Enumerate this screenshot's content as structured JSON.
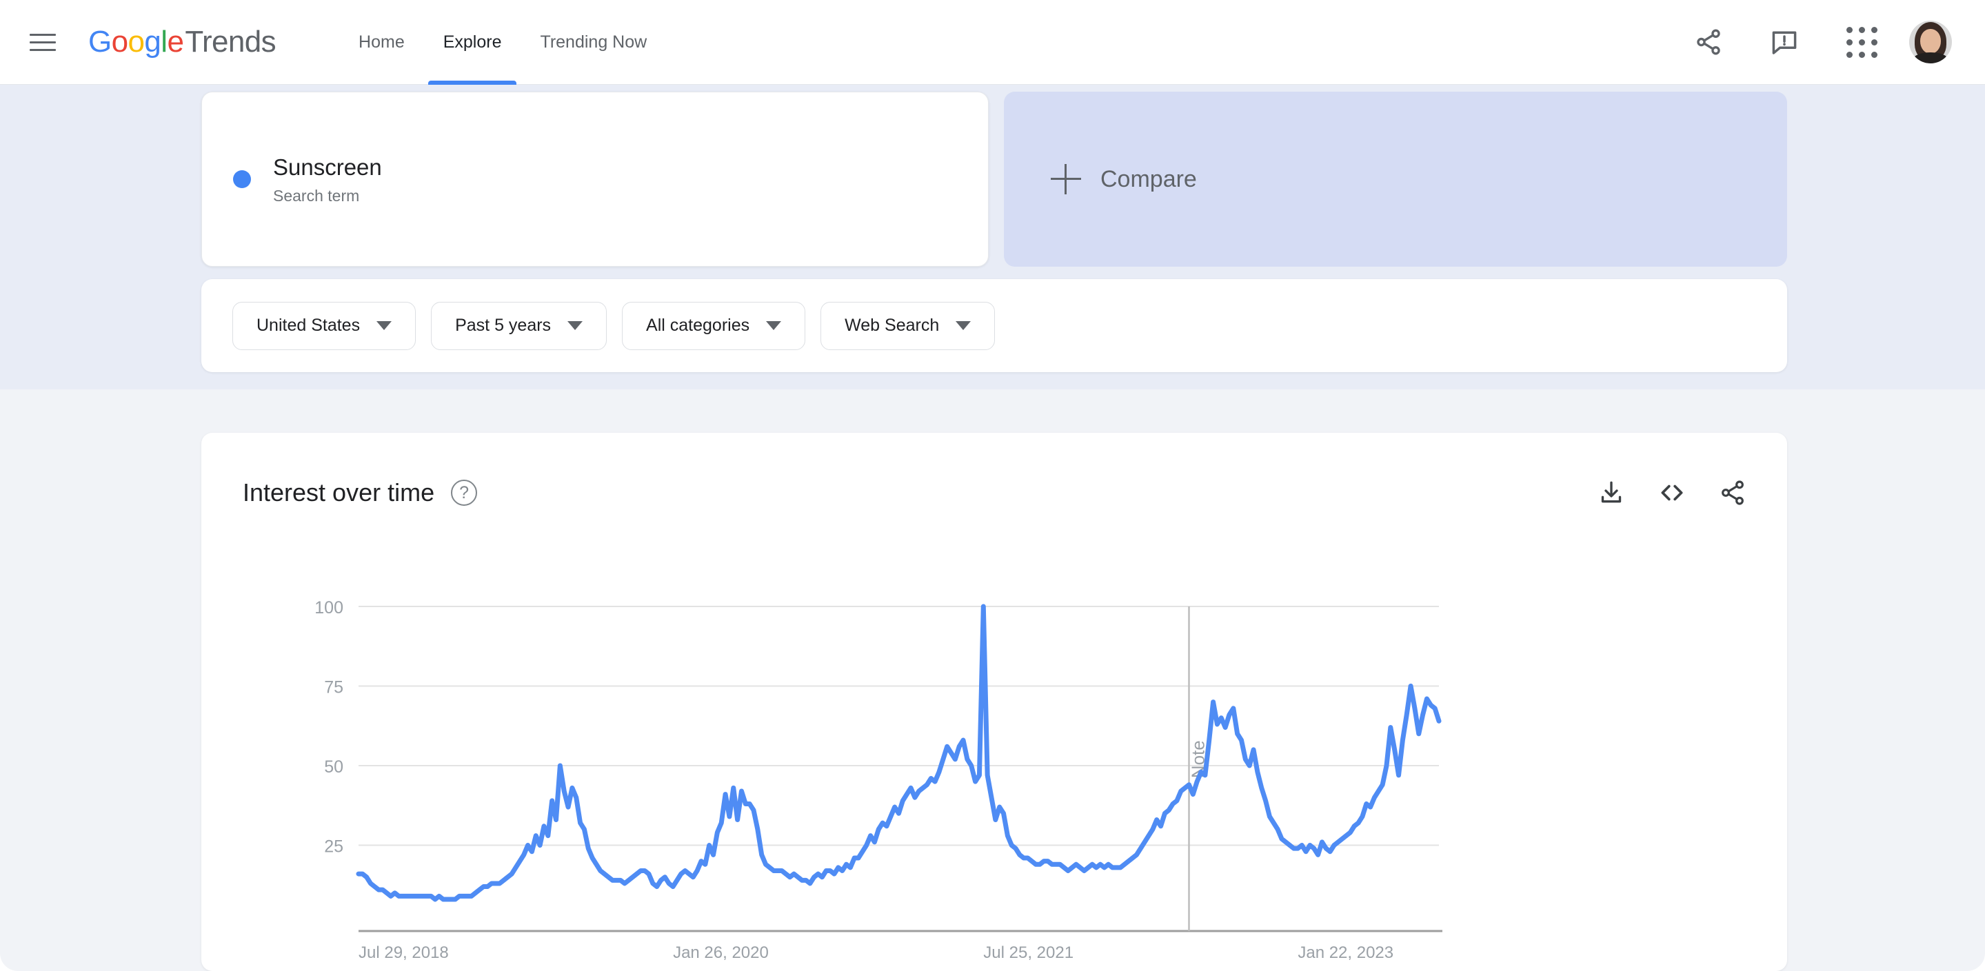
{
  "header": {
    "menu_icon": "hamburger-menu-icon",
    "brand": {
      "g1": "G",
      "o1": "o",
      "o2": "o",
      "g2": "g",
      "l1": "l",
      "e1": "e",
      "trends": "Trends"
    },
    "nav": [
      {
        "label": "Home",
        "active": false
      },
      {
        "label": "Explore",
        "active": true
      },
      {
        "label": "Trending Now",
        "active": false
      }
    ],
    "icons": [
      "share-icon",
      "feedback-icon",
      "google-apps-icon",
      "account-avatar"
    ]
  },
  "query": {
    "term": {
      "name": "Sunscreen",
      "kind": "Search term",
      "color": "#4285F4"
    },
    "compare": {
      "label": "Compare",
      "icon": "plus-icon"
    }
  },
  "filters": [
    {
      "name": "location",
      "label": "United States"
    },
    {
      "name": "time-range",
      "label": "Past 5 years"
    },
    {
      "name": "category",
      "label": "All categories"
    },
    {
      "name": "search-type",
      "label": "Web Search"
    }
  ],
  "chart_card": {
    "title": "Interest over time",
    "help": "?",
    "actions": [
      "download-icon",
      "embed-code-icon",
      "share-icon"
    ]
  },
  "chart_data": {
    "type": "line",
    "title": "Interest over time",
    "xlabel": "",
    "ylabel": "",
    "ylim": [
      0,
      100
    ],
    "yticks": [
      100,
      75,
      50,
      25
    ],
    "grid": true,
    "legend": false,
    "line_color": "#4F8CF4",
    "x_tick_labels": [
      "Jul 29, 2018",
      "Jan 26, 2020",
      "Jul 25, 2021",
      "Jan 22, 2023"
    ],
    "x_tick_positions": [
      0,
      78,
      155,
      233
    ],
    "annotation": {
      "label": "Note",
      "x_index": 206,
      "orientation": "vertical"
    },
    "series": [
      {
        "name": "Sunscreen",
        "values": [
          16,
          16,
          15,
          13,
          12,
          11,
          11,
          10,
          9,
          10,
          9,
          9,
          9,
          9,
          9,
          9,
          9,
          9,
          9,
          8,
          9,
          8,
          8,
          8,
          8,
          9,
          9,
          9,
          9,
          10,
          11,
          12,
          12,
          13,
          13,
          13,
          14,
          15,
          16,
          18,
          20,
          22,
          25,
          23,
          28,
          25,
          31,
          28,
          39,
          33,
          50,
          42,
          37,
          43,
          40,
          32,
          30,
          24,
          21,
          19,
          17,
          16,
          15,
          14,
          14,
          14,
          13,
          14,
          15,
          16,
          17,
          17,
          16,
          13,
          12,
          14,
          15,
          13,
          12,
          14,
          16,
          17,
          16,
          15,
          17,
          20,
          19,
          25,
          22,
          29,
          32,
          41,
          34,
          43,
          33,
          42,
          38,
          38,
          36,
          30,
          22,
          19,
          18,
          17,
          17,
          17,
          16,
          15,
          16,
          15,
          14,
          14,
          13,
          15,
          16,
          15,
          17,
          17,
          16,
          18,
          17,
          19,
          18,
          21,
          21,
          23,
          25,
          28,
          26,
          30,
          32,
          31,
          34,
          37,
          35,
          39,
          41,
          43,
          40,
          42,
          43,
          44,
          46,
          45,
          48,
          52,
          56,
          54,
          52,
          56,
          58,
          52,
          50,
          45,
          47,
          100,
          47,
          40,
          33,
          37,
          35,
          28,
          25,
          24,
          22,
          21,
          21,
          20,
          19,
          19,
          20,
          20,
          19,
          19,
          19,
          18,
          17,
          18,
          19,
          18,
          17,
          18,
          19,
          18,
          19,
          18,
          19,
          18,
          18,
          18,
          19,
          20,
          21,
          22,
          24,
          26,
          28,
          30,
          33,
          31,
          35,
          36,
          38,
          39,
          42,
          43,
          44,
          41,
          45,
          48,
          47,
          58,
          70,
          63,
          65,
          62,
          66,
          68,
          60,
          58,
          52,
          50,
          55,
          48,
          43,
          39,
          34,
          32,
          30,
          27,
          26,
          25,
          24,
          24,
          25,
          23,
          25,
          24,
          22,
          26,
          24,
          23,
          25,
          26,
          27,
          28,
          29,
          31,
          32,
          34,
          38,
          37,
          40,
          42,
          44,
          50,
          62,
          55,
          47,
          58,
          66,
          75,
          68,
          60,
          66,
          71,
          69,
          68,
          64
        ]
      }
    ]
  }
}
